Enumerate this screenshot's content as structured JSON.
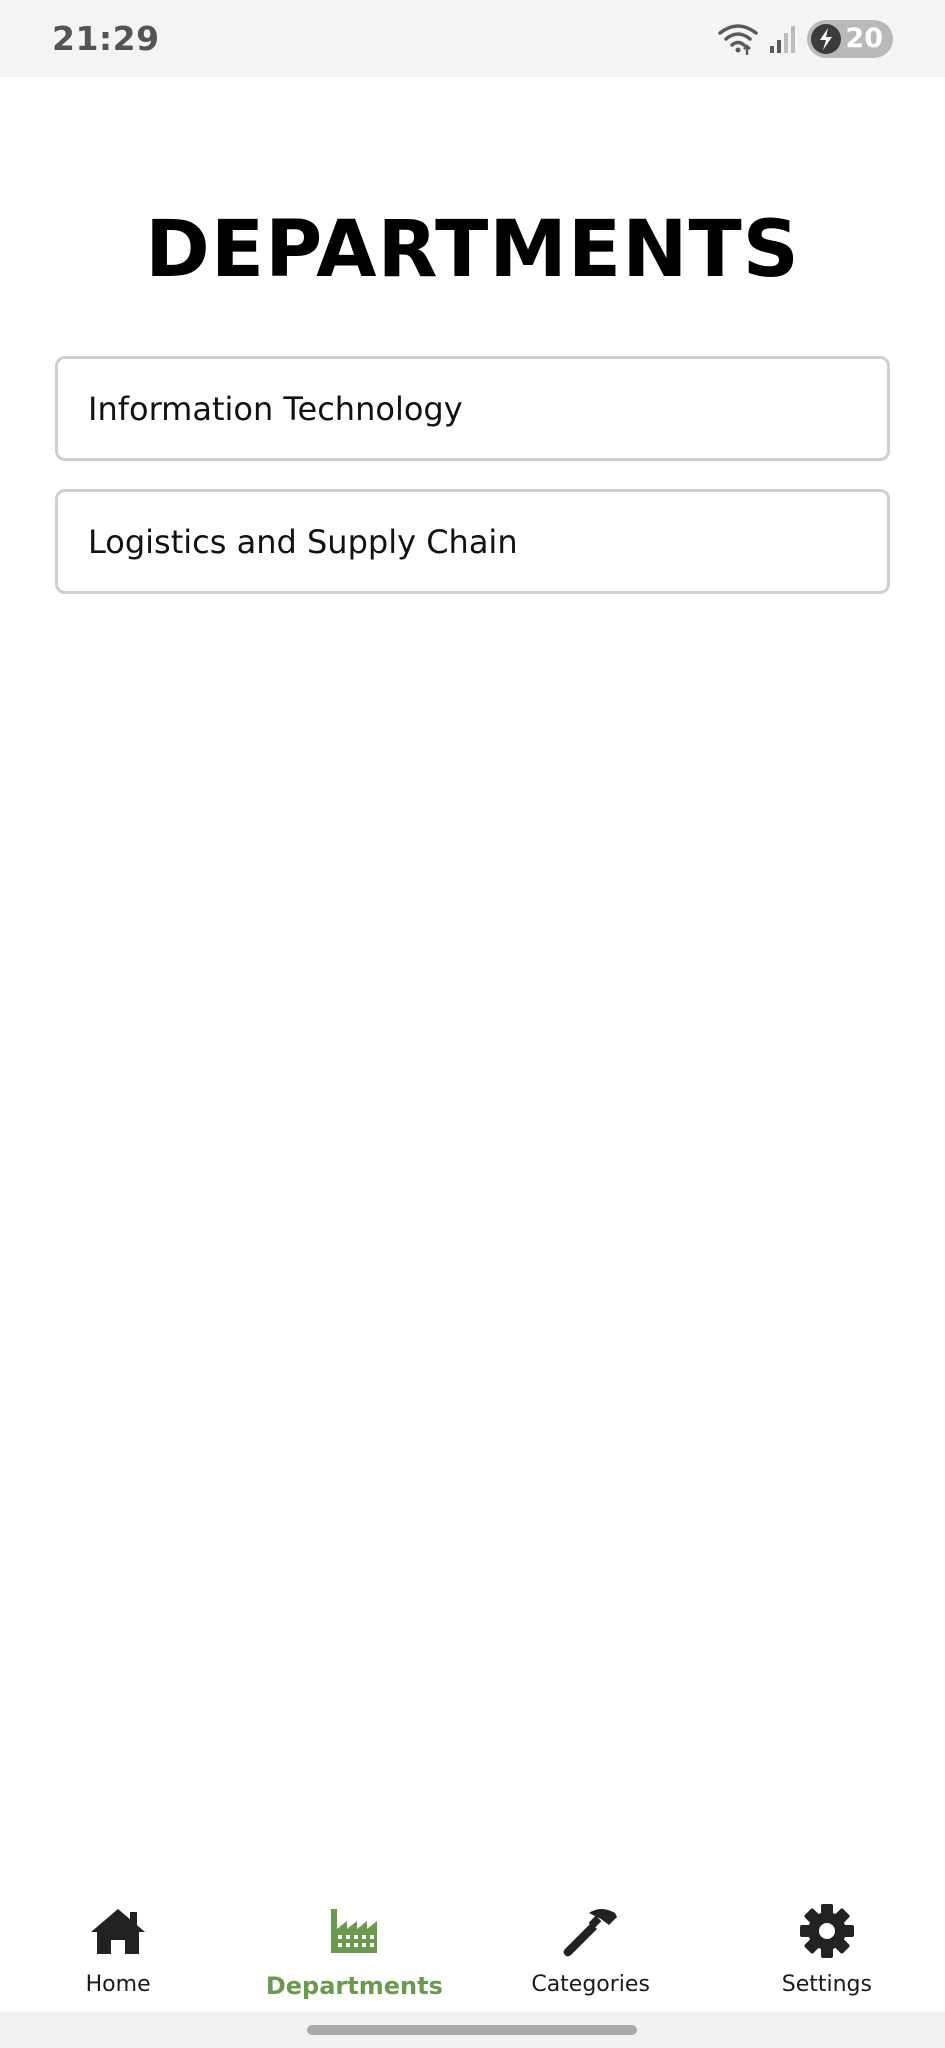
{
  "status_bar": {
    "time": "21:29",
    "battery_level": "20",
    "icons": [
      "wifi-icon",
      "signal-icon",
      "battery-charging-icon"
    ]
  },
  "page": {
    "title": "DEPARTMENTS"
  },
  "departments": [
    {
      "label": "Information Technology"
    },
    {
      "label": "Logistics and Supply Chain"
    }
  ],
  "bottom_nav": {
    "active": "Departments",
    "active_color": "#6a9a4c",
    "items": [
      {
        "label": "Home",
        "icon": "home-icon"
      },
      {
        "label": "Departments",
        "icon": "factory-icon"
      },
      {
        "label": "Categories",
        "icon": "hammer-icon"
      },
      {
        "label": "Settings",
        "icon": "gear-icon"
      }
    ]
  }
}
